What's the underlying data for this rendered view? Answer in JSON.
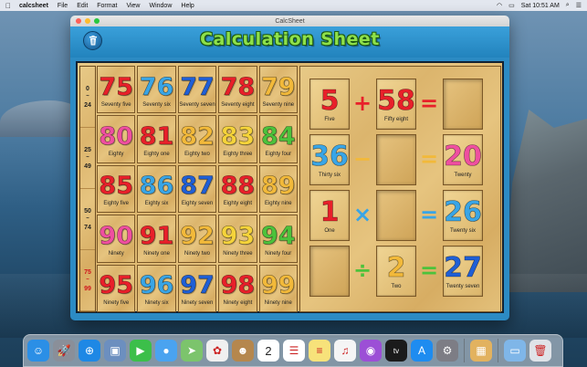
{
  "menubar": {
    "app_name": "calcsheet",
    "menus": [
      "File",
      "Edit",
      "Format",
      "View",
      "Window",
      "Help"
    ],
    "clock": "Sat 10:51 AM"
  },
  "window": {
    "title": "CalcSheet",
    "heading": "Calculation Sheet"
  },
  "ranges": [
    {
      "from": "0",
      "to": "24",
      "color": "#222222"
    },
    {
      "from": "25",
      "to": "49",
      "color": "#222222"
    },
    {
      "from": "50",
      "to": "74",
      "color": "#222222"
    },
    {
      "from": "75",
      "to": "99",
      "color": "#d0121b"
    }
  ],
  "grid": [
    [
      {
        "num": "75",
        "word": "Seventy five",
        "color": "#e8202a"
      },
      {
        "num": "76",
        "word": "Seventy six",
        "color": "#39a5e6"
      },
      {
        "num": "77",
        "word": "Seventy seven",
        "color": "#1f5fd6"
      },
      {
        "num": "78",
        "word": "Seventy eight",
        "color": "#e8202a"
      },
      {
        "num": "79",
        "word": "Seventy nine",
        "color": "#f2b93a"
      }
    ],
    [
      {
        "num": "80",
        "word": "Eighty",
        "color": "#ef4fa0"
      },
      {
        "num": "81",
        "word": "Eighty one",
        "color": "#e8202a"
      },
      {
        "num": "82",
        "word": "Eighty two",
        "color": "#f2b93a"
      },
      {
        "num": "83",
        "word": "Eighty three",
        "color": "#f5d33a"
      },
      {
        "num": "84",
        "word": "Eighty four",
        "color": "#4cc23b"
      }
    ],
    [
      {
        "num": "85",
        "word": "Eighty five",
        "color": "#e8202a"
      },
      {
        "num": "86",
        "word": "Eighty six",
        "color": "#39a5e6"
      },
      {
        "num": "87",
        "word": "Eighty seven",
        "color": "#1f5fd6"
      },
      {
        "num": "88",
        "word": "Eighty eight",
        "color": "#e8202a"
      },
      {
        "num": "89",
        "word": "Eighty nine",
        "color": "#f2b93a"
      }
    ],
    [
      {
        "num": "90",
        "word": "Ninety",
        "color": "#ef4fa0"
      },
      {
        "num": "91",
        "word": "Ninety one",
        "color": "#e8202a"
      },
      {
        "num": "92",
        "word": "Ninety two",
        "color": "#f2b93a"
      },
      {
        "num": "93",
        "word": "Ninety three",
        "color": "#f5d33a"
      },
      {
        "num": "94",
        "word": "Ninety four",
        "color": "#4cc23b"
      }
    ],
    [
      {
        "num": "95",
        "word": "Ninety five",
        "color": "#e8202a"
      },
      {
        "num": "96",
        "word": "Ninety six",
        "color": "#39a5e6"
      },
      {
        "num": "97",
        "word": "Ninety seven",
        "color": "#1f5fd6"
      },
      {
        "num": "98",
        "word": "Ninety eight",
        "color": "#e8202a"
      },
      {
        "num": "99",
        "word": "Ninety nine",
        "color": "#f2b93a"
      }
    ]
  ],
  "equations": [
    {
      "a": {
        "num": "5",
        "word": "Five",
        "color": "#e8202a"
      },
      "op": "+",
      "op_color": "#e8202a",
      "b": {
        "num": "58",
        "word": "Fifty eight",
        "color": "#e8202a"
      },
      "eq_color": "#e8202a",
      "result": null
    },
    {
      "a": {
        "num": "36",
        "word": "Thirty six",
        "color": "#39a5e6"
      },
      "op": "−",
      "op_color": "#f2b93a",
      "b": null,
      "eq_color": "#f2b93a",
      "result": {
        "num": "20",
        "word": "Twenty",
        "color": "#ef4fa0"
      }
    },
    {
      "a": {
        "num": "1",
        "word": "One",
        "color": "#e8202a"
      },
      "op": "×",
      "op_color": "#39a5e6",
      "b": null,
      "eq_color": "#39a5e6",
      "result": {
        "num": "26",
        "word": "Twenty six",
        "color": "#39a5e6"
      }
    },
    {
      "a": null,
      "op": "÷",
      "op_color": "#4cc23b",
      "b": {
        "num": "2",
        "word": "Two",
        "color": "#f2b93a"
      },
      "eq_color": "#4cc23b",
      "result": {
        "num": "27",
        "word": "Twenty seven",
        "color": "#1f5fd6"
      }
    }
  ],
  "dock": [
    {
      "name": "finder",
      "icon": "finder-icon",
      "bg": "#2b8fe6",
      "glyph": "☺"
    },
    {
      "name": "launchpad",
      "icon": "rocket-icon",
      "bg": "#8a8f99",
      "glyph": "🚀"
    },
    {
      "name": "safari",
      "icon": "compass-icon",
      "bg": "#1e88e5",
      "glyph": "⊕"
    },
    {
      "name": "preview",
      "icon": "photo-icon",
      "bg": "#6c8fbf",
      "glyph": "▣"
    },
    {
      "name": "facetime",
      "icon": "video-icon",
      "bg": "#3cbf4a",
      "glyph": "▶"
    },
    {
      "name": "messages",
      "icon": "speech-bubble-icon",
      "bg": "#4aa3f0",
      "glyph": "●"
    },
    {
      "name": "maps",
      "icon": "map-icon",
      "bg": "#7cc46c",
      "glyph": "➤"
    },
    {
      "name": "photos",
      "icon": "flower-icon",
      "bg": "#f0f0f0",
      "glyph": "✿"
    },
    {
      "name": "contacts",
      "icon": "address-book-icon",
      "bg": "#b5874d",
      "glyph": "☻"
    },
    {
      "name": "calendar",
      "icon": "calendar-icon",
      "bg": "#ffffff",
      "glyph": "2"
    },
    {
      "name": "reminders",
      "icon": "checklist-icon",
      "bg": "#ffffff",
      "glyph": "☰"
    },
    {
      "name": "notes",
      "icon": "notepad-icon",
      "bg": "#f7e27a",
      "glyph": "≡"
    },
    {
      "name": "music",
      "icon": "music-note-icon",
      "bg": "#f5f5f5",
      "glyph": "♫"
    },
    {
      "name": "podcasts",
      "icon": "podcast-icon",
      "bg": "#9c4fd6",
      "glyph": "◉"
    },
    {
      "name": "tv",
      "icon": "tv-icon",
      "bg": "#1b1b1b",
      "glyph": "tv"
    },
    {
      "name": "app-store",
      "icon": "app-store-icon",
      "bg": "#1e8cf0",
      "glyph": "A"
    },
    {
      "name": "system-preferences",
      "icon": "gear-icon",
      "bg": "#7d7d85",
      "glyph": "⚙"
    },
    {
      "name": "calcsheet",
      "icon": "calcsheet-icon",
      "bg": "#e2b25f",
      "glyph": "▦"
    },
    {
      "name": "downloads",
      "icon": "folder-icon",
      "bg": "#7fb6e8",
      "glyph": "▭"
    },
    {
      "name": "trash",
      "icon": "trash-icon",
      "bg": "#dfe3e8",
      "glyph": "🗑"
    }
  ]
}
